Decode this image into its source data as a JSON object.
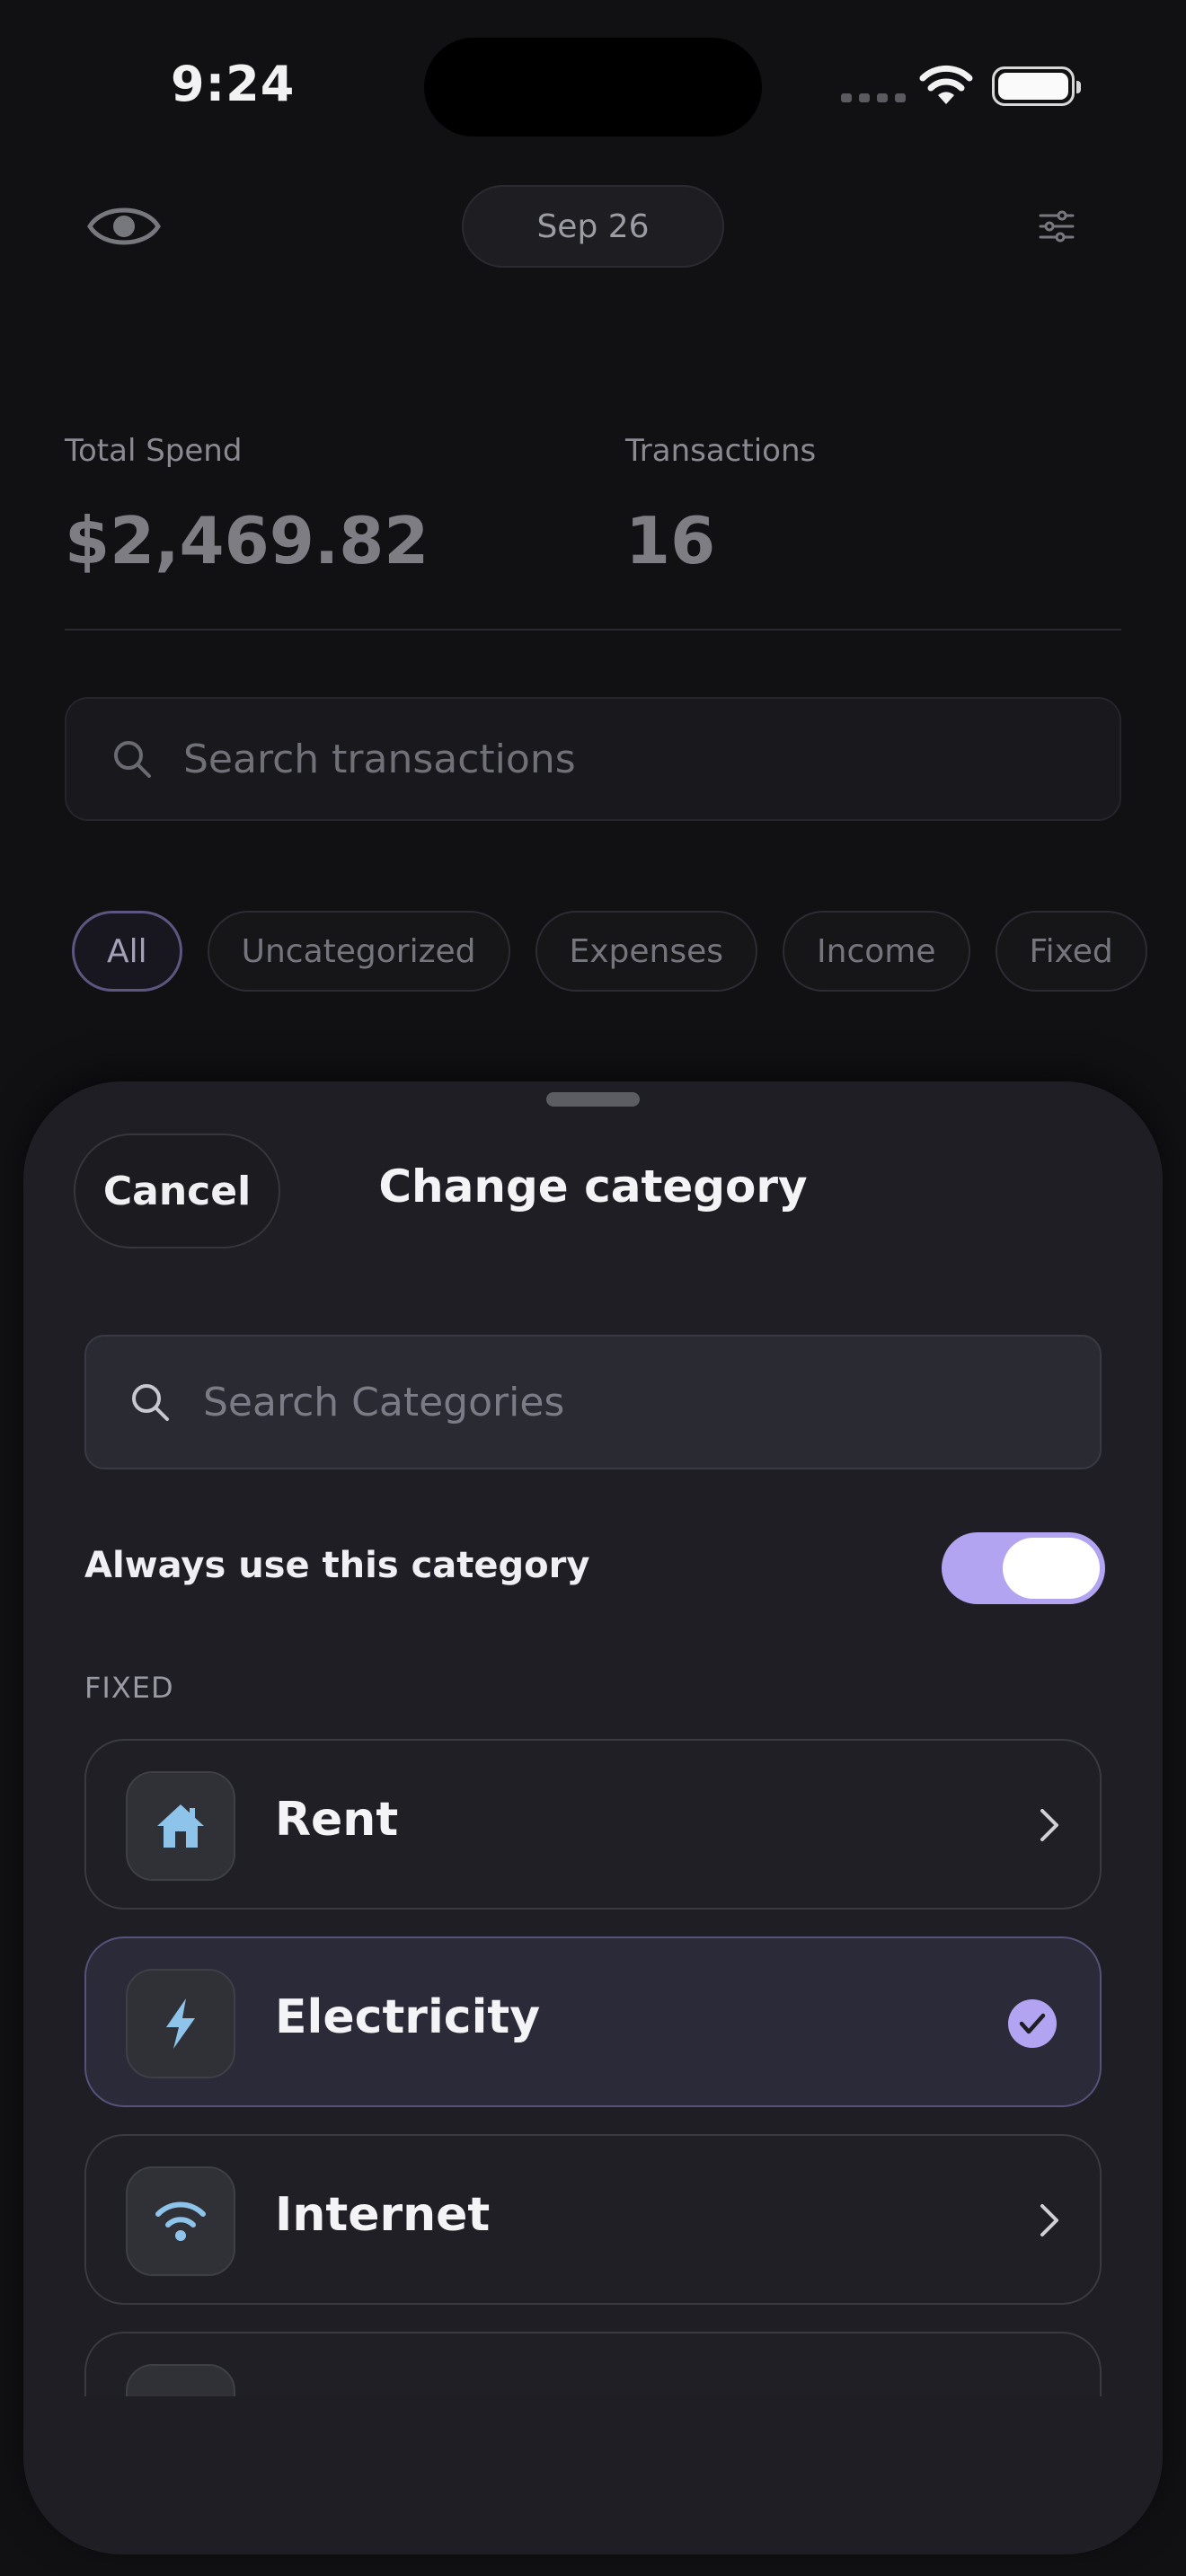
{
  "status": {
    "time": "9:24"
  },
  "nav": {
    "date": "Sep 26"
  },
  "stats": {
    "total_label": "Total Spend",
    "total_value": "$2,469.82",
    "tx_label": "Transactions",
    "tx_value": "16"
  },
  "search": {
    "placeholder": "Search transactions"
  },
  "filters": [
    "All",
    "Uncategorized",
    "Expenses",
    "Income",
    "Fixed"
  ],
  "sheet": {
    "cancel": "Cancel",
    "title": "Change category",
    "search_placeholder": "Search Categories",
    "always_label": "Always use this category",
    "always_on": true,
    "section": "FIXED",
    "categories": [
      {
        "name": "Rent",
        "icon": "house-icon"
      },
      {
        "name": "Electricity",
        "icon": "bolt-icon",
        "selected": true
      },
      {
        "name": "Internet",
        "icon": "wifi-icon"
      }
    ]
  },
  "colors": {
    "accent": "#b3a4f2",
    "icon": "#8ec3ea"
  }
}
